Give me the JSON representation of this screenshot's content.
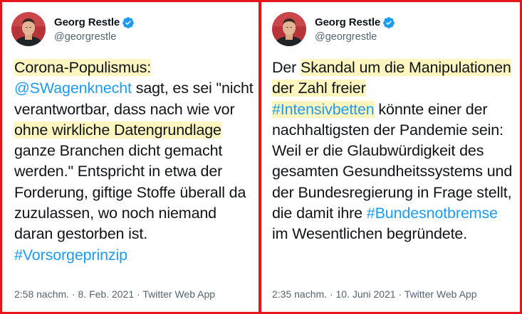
{
  "tweets": [
    {
      "author": {
        "display_name": "Georg Restle",
        "handle": "@georgrestle",
        "verified_icon": "verified-badge-icon",
        "avatar_icon": "profile-photo"
      },
      "text": {
        "hl1": "Corona-Populismus:",
        "mention": "@SWagenknecht",
        "t1": " sagt, es sei \"nicht verantwortbar, dass nach wie vor ",
        "hl2": "ohne wirkliche Datengrundlage",
        "t2": " ganze Branchen dicht gemacht werden.\" Entspricht in etwa der Forderung, giftige Stoffe überall da zuzulassen, wo noch niemand daran gestorben ist.",
        "hashtag": "#Vorsorgeprinzip"
      },
      "meta": {
        "time": "2:58 nachm.",
        "sep1": " · ",
        "date": "8. Feb. 2021",
        "sep2": " · ",
        "source": "Twitter Web App"
      }
    },
    {
      "author": {
        "display_name": "Georg Restle",
        "handle": "@georgrestle",
        "verified_icon": "verified-badge-icon",
        "avatar_icon": "profile-photo"
      },
      "text": {
        "t0": "Der ",
        "hl1": "Skandal um die Manipulationen der Zahl freier",
        "hashtag1": "#Intensivbetten",
        "t1": " könnte einer der nachhaltigsten der Pandemie sein: Weil er die Glaubwürdigkeit des gesamten Gesundheitssystems und der Bundesregierung in Frage stellt, die damit ihre ",
        "hashtag2": "#Bundesnotbremse",
        "t2": " im Wesentlichen begründete."
      },
      "meta": {
        "time": "2:35 nachm.",
        "sep1": " · ",
        "date": "10. Juni 2021",
        "sep2": " · ",
        "source": "Twitter Web App"
      }
    }
  ],
  "colors": {
    "frame": "#e8141c",
    "highlight": "#fff5bf",
    "link": "#1d9bf0",
    "text": "#0f1419",
    "muted": "#536471",
    "verified": "#1d9bf0"
  }
}
